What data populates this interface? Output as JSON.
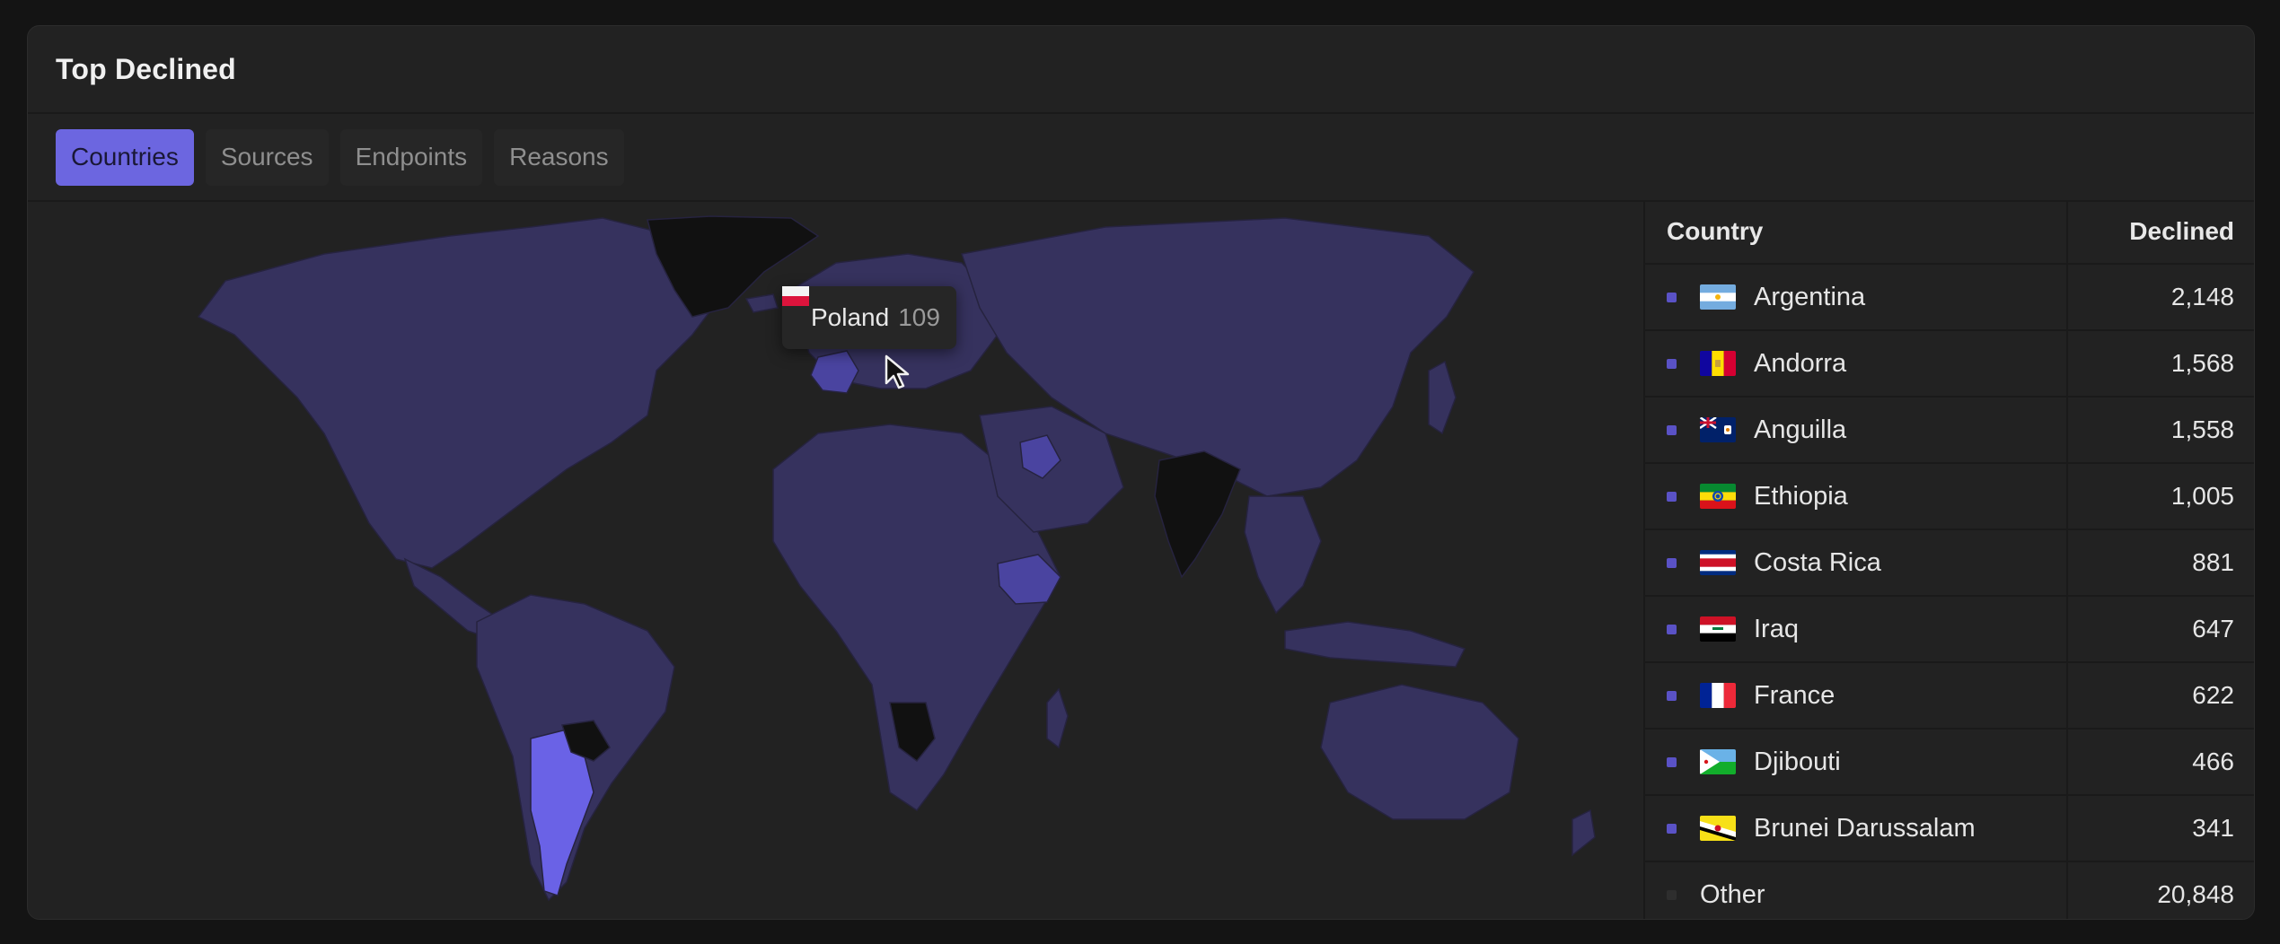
{
  "card": {
    "title": "Top Declined"
  },
  "tabs": [
    {
      "label": "Countries",
      "active": true
    },
    {
      "label": "Sources",
      "active": false
    },
    {
      "label": "Endpoints",
      "active": false
    },
    {
      "label": "Reasons",
      "active": false
    }
  ],
  "tooltip": {
    "country": "Poland",
    "value": "109",
    "flag": "poland-flag-icon"
  },
  "table": {
    "headers": {
      "country": "Country",
      "declined": "Declined"
    },
    "rows": [
      {
        "country": "Argentina",
        "declined": "2,148",
        "flag": "argentina-flag-icon"
      },
      {
        "country": "Andorra",
        "declined": "1,568",
        "flag": "andorra-flag-icon"
      },
      {
        "country": "Anguilla",
        "declined": "1,558",
        "flag": "anguilla-flag-icon"
      },
      {
        "country": "Ethiopia",
        "declined": "1,005",
        "flag": "ethiopia-flag-icon"
      },
      {
        "country": "Costa Rica",
        "declined": "881",
        "flag": "costa-rica-flag-icon"
      },
      {
        "country": "Iraq",
        "declined": "647",
        "flag": "iraq-flag-icon"
      },
      {
        "country": "France",
        "declined": "622",
        "flag": "france-flag-icon"
      },
      {
        "country": "Djibouti",
        "declined": "466",
        "flag": "djibouti-flag-icon"
      },
      {
        "country": "Brunei Darussalam",
        "declined": "341",
        "flag": "brunei-flag-icon"
      }
    ],
    "other": {
      "label": "Other",
      "declined": "20,848"
    }
  },
  "colors": {
    "accent": "#6c66e0",
    "map_base": "#36325e",
    "map_highlight": "#6a62e6",
    "map_mid": "#4a44a0",
    "map_nodata": "#111111",
    "series_dot": "#5a52c6"
  }
}
